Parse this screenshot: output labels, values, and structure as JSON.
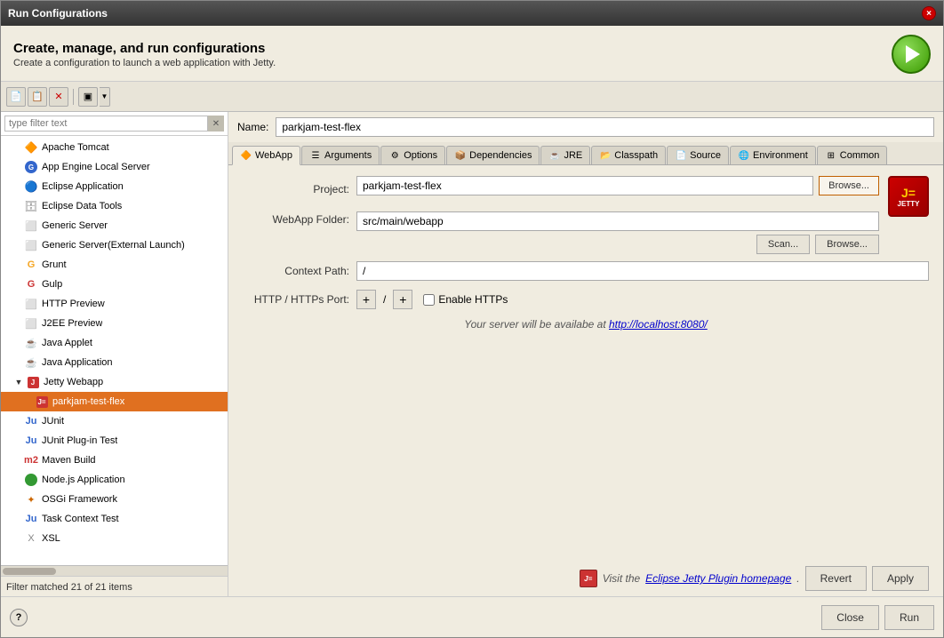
{
  "window": {
    "title": "Run Configurations",
    "close_btn": "×"
  },
  "header": {
    "title": "Create, manage, and run configurations",
    "subtitle": "Create a configuration to launch a web application with Jetty."
  },
  "toolbar": {
    "new_btn": "📄",
    "copy_btn": "📋",
    "delete_btn": "✕",
    "filter_btn": "▣",
    "dropdown_btn": "▼"
  },
  "filter": {
    "placeholder": "type filter text"
  },
  "sidebar": {
    "items": [
      {
        "id": "apache-tomcat",
        "label": "Apache Tomcat",
        "icon": "tomcat",
        "indent": 1,
        "type": "item"
      },
      {
        "id": "app-engine",
        "label": "App Engine Local Server",
        "icon": "appengine",
        "indent": 1,
        "type": "item"
      },
      {
        "id": "eclipse-app",
        "label": "Eclipse Application",
        "icon": "eclipse",
        "indent": 1,
        "type": "item"
      },
      {
        "id": "eclipse-data",
        "label": "Eclipse Data Tools",
        "icon": "eclipse-data",
        "indent": 1,
        "type": "item"
      },
      {
        "id": "generic-server",
        "label": "Generic Server",
        "icon": "generic",
        "indent": 1,
        "type": "item"
      },
      {
        "id": "generic-server-ext",
        "label": "Generic Server(External Launch)",
        "icon": "generic",
        "indent": 1,
        "type": "item"
      },
      {
        "id": "grunt",
        "label": "Grunt",
        "icon": "grunt",
        "indent": 1,
        "type": "item"
      },
      {
        "id": "gulp",
        "label": "Gulp",
        "icon": "gulp",
        "indent": 1,
        "type": "item"
      },
      {
        "id": "http-preview",
        "label": "HTTP Preview",
        "icon": "http",
        "indent": 1,
        "type": "item"
      },
      {
        "id": "j2ee-preview",
        "label": "J2EE Preview",
        "icon": "j2ee",
        "indent": 1,
        "type": "item"
      },
      {
        "id": "java-applet",
        "label": "Java Applet",
        "icon": "java",
        "indent": 1,
        "type": "item"
      },
      {
        "id": "java-app",
        "label": "Java Application",
        "icon": "java",
        "indent": 1,
        "type": "item"
      },
      {
        "id": "jetty-webapp",
        "label": "Jetty Webapp",
        "icon": "jetty",
        "indent": 1,
        "type": "group",
        "expanded": true
      },
      {
        "id": "parkjam-test-flex",
        "label": "parkjam-test-flex",
        "icon": "jetty-sub",
        "indent": 2,
        "type": "item",
        "selected": true
      },
      {
        "id": "junit",
        "label": "JUnit",
        "icon": "junit",
        "indent": 1,
        "type": "item"
      },
      {
        "id": "junit-plugin",
        "label": "JUnit Plug-in Test",
        "icon": "junit",
        "indent": 1,
        "type": "item"
      },
      {
        "id": "maven-build",
        "label": "Maven Build",
        "icon": "maven",
        "indent": 1,
        "type": "item"
      },
      {
        "id": "nodejs-app",
        "label": "Node.js Application",
        "icon": "node",
        "indent": 1,
        "type": "item"
      },
      {
        "id": "osgi",
        "label": "OSGi Framework",
        "icon": "osgi",
        "indent": 1,
        "type": "item"
      },
      {
        "id": "task-context",
        "label": "Task Context Test",
        "icon": "task",
        "indent": 1,
        "type": "item"
      },
      {
        "id": "xsl",
        "label": "XSL",
        "icon": "xsl",
        "indent": 1,
        "type": "item"
      }
    ],
    "footer": "Filter matched 21 of 21 items"
  },
  "name_field": {
    "label": "Name:",
    "value": "parkjam-test-flex"
  },
  "tabs": [
    {
      "id": "webapp",
      "label": "WebApp",
      "active": true,
      "icon": "🔶"
    },
    {
      "id": "arguments",
      "label": "Arguments",
      "active": false,
      "icon": "☰"
    },
    {
      "id": "options",
      "label": "Options",
      "active": false,
      "icon": "⚙"
    },
    {
      "id": "dependencies",
      "label": "Dependencies",
      "active": false,
      "icon": "📦"
    },
    {
      "id": "jre",
      "label": "JRE",
      "active": false,
      "icon": "☕"
    },
    {
      "id": "classpath",
      "label": "Classpath",
      "active": false,
      "icon": "📂"
    },
    {
      "id": "source",
      "label": "Source",
      "active": false,
      "icon": "📄"
    },
    {
      "id": "environment",
      "label": "Environment",
      "active": false,
      "icon": "🌐"
    },
    {
      "id": "common",
      "label": "Common",
      "active": false,
      "icon": "⊞"
    }
  ],
  "webapp_panel": {
    "project_label": "Project:",
    "project_value": "parkjam-test-flex",
    "browse_btn": "Browse...",
    "webapp_folder_label": "WebApp Folder:",
    "webapp_folder_value": "src/main/webapp",
    "scan_btn": "Scan...",
    "browse2_btn": "Browse...",
    "context_path_label": "Context Path:",
    "context_path_value": "/",
    "port_label": "HTTP / HTTPs Port:",
    "port_plus1": "+",
    "port_separator": "/",
    "port_plus2": "+",
    "enable_https_label": "Enable HTTPs",
    "server_msg": "Your server will be availabe at",
    "server_link": "http://localhost:8080/",
    "jetty_footer_msg": "Visit the",
    "jetty_footer_link": "Eclipse Jetty Plugin homepage",
    "jetty_footer_period": "."
  },
  "bottom": {
    "help_btn": "?",
    "revert_btn": "Revert",
    "apply_btn": "Apply",
    "close_btn": "Close",
    "run_btn": "Run"
  }
}
